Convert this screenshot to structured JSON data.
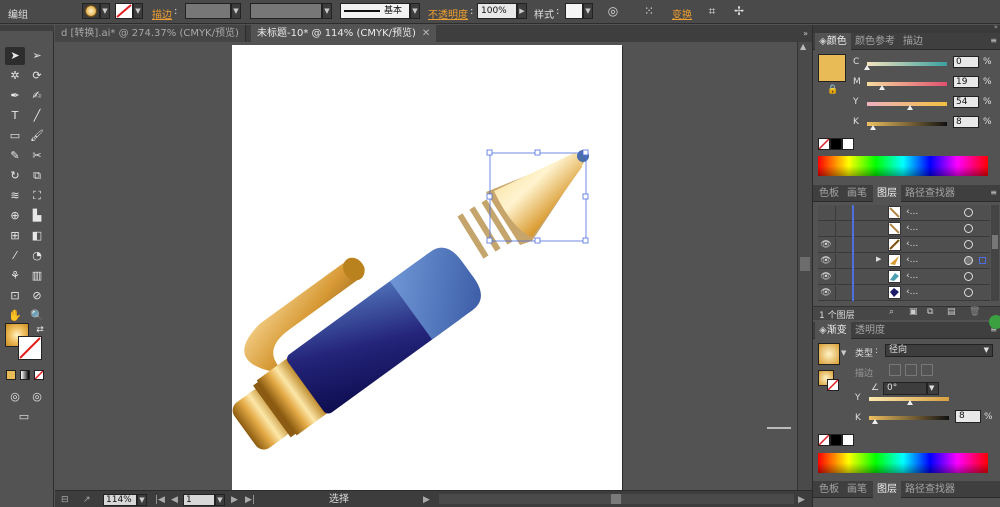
{
  "topbar": {
    "group_label": "编组",
    "stroke_label": "描边",
    "stroke_style_label": "基本",
    "opacity_label": "不透明度",
    "opacity_value": "100%",
    "style_label": "样式",
    "transform_label": "变换"
  },
  "tabs": [
    {
      "label": "d [转换].ai* @ 274.37% (CMYK/预览)",
      "active": false
    },
    {
      "label": "未标题-10* @ 114% (CMYK/预览)",
      "active": true
    }
  ],
  "status": {
    "zoom": "114%",
    "page": "1",
    "mode": "选择"
  },
  "color_panel": {
    "tabs": [
      "颜色",
      "颜色参考",
      "描边"
    ],
    "fill_color": "#e9bb57",
    "channels": [
      {
        "name": "C",
        "value": "0",
        "fraction": 0.0
      },
      {
        "name": "M",
        "value": "19",
        "fraction": 0.19
      },
      {
        "name": "Y",
        "value": "54",
        "fraction": 0.54
      },
      {
        "name": "K",
        "value": "8",
        "fraction": 0.08
      }
    ],
    "pct": "%"
  },
  "layers_panel": {
    "tabs": [
      "色板",
      "画笔",
      "图层",
      "路径查找器"
    ],
    "rows": [
      {
        "name": "‹...",
        "visible": false,
        "thumb": "stripe"
      },
      {
        "name": "‹...",
        "visible": false,
        "thumb": "stripe"
      },
      {
        "name": "‹...",
        "visible": true,
        "thumb": "stripe-dark"
      },
      {
        "name": "‹...",
        "visible": true,
        "thumb": "cone",
        "expanded": true
      },
      {
        "name": "‹...",
        "visible": true,
        "thumb": "teal"
      },
      {
        "name": "‹...",
        "visible": true,
        "thumb": "navy"
      }
    ],
    "footer": "1 个图层"
  },
  "gradient_panel": {
    "tabs": [
      "渐变",
      "透明度"
    ],
    "type_label": "类型",
    "type_value": "径向",
    "stroke_label": "描边",
    "angle_value": "0°",
    "y_label": "Y",
    "k_label": "K",
    "k_value": "8",
    "k_fraction": 0.08,
    "pct": "%"
  },
  "bottom_tabs": [
    "色板",
    "画笔",
    "图层",
    "路径查找器"
  ],
  "accent_colors": {
    "selection": "#4d6fe0",
    "gold": "#e9bb57",
    "navy": "#1c1c6a"
  }
}
